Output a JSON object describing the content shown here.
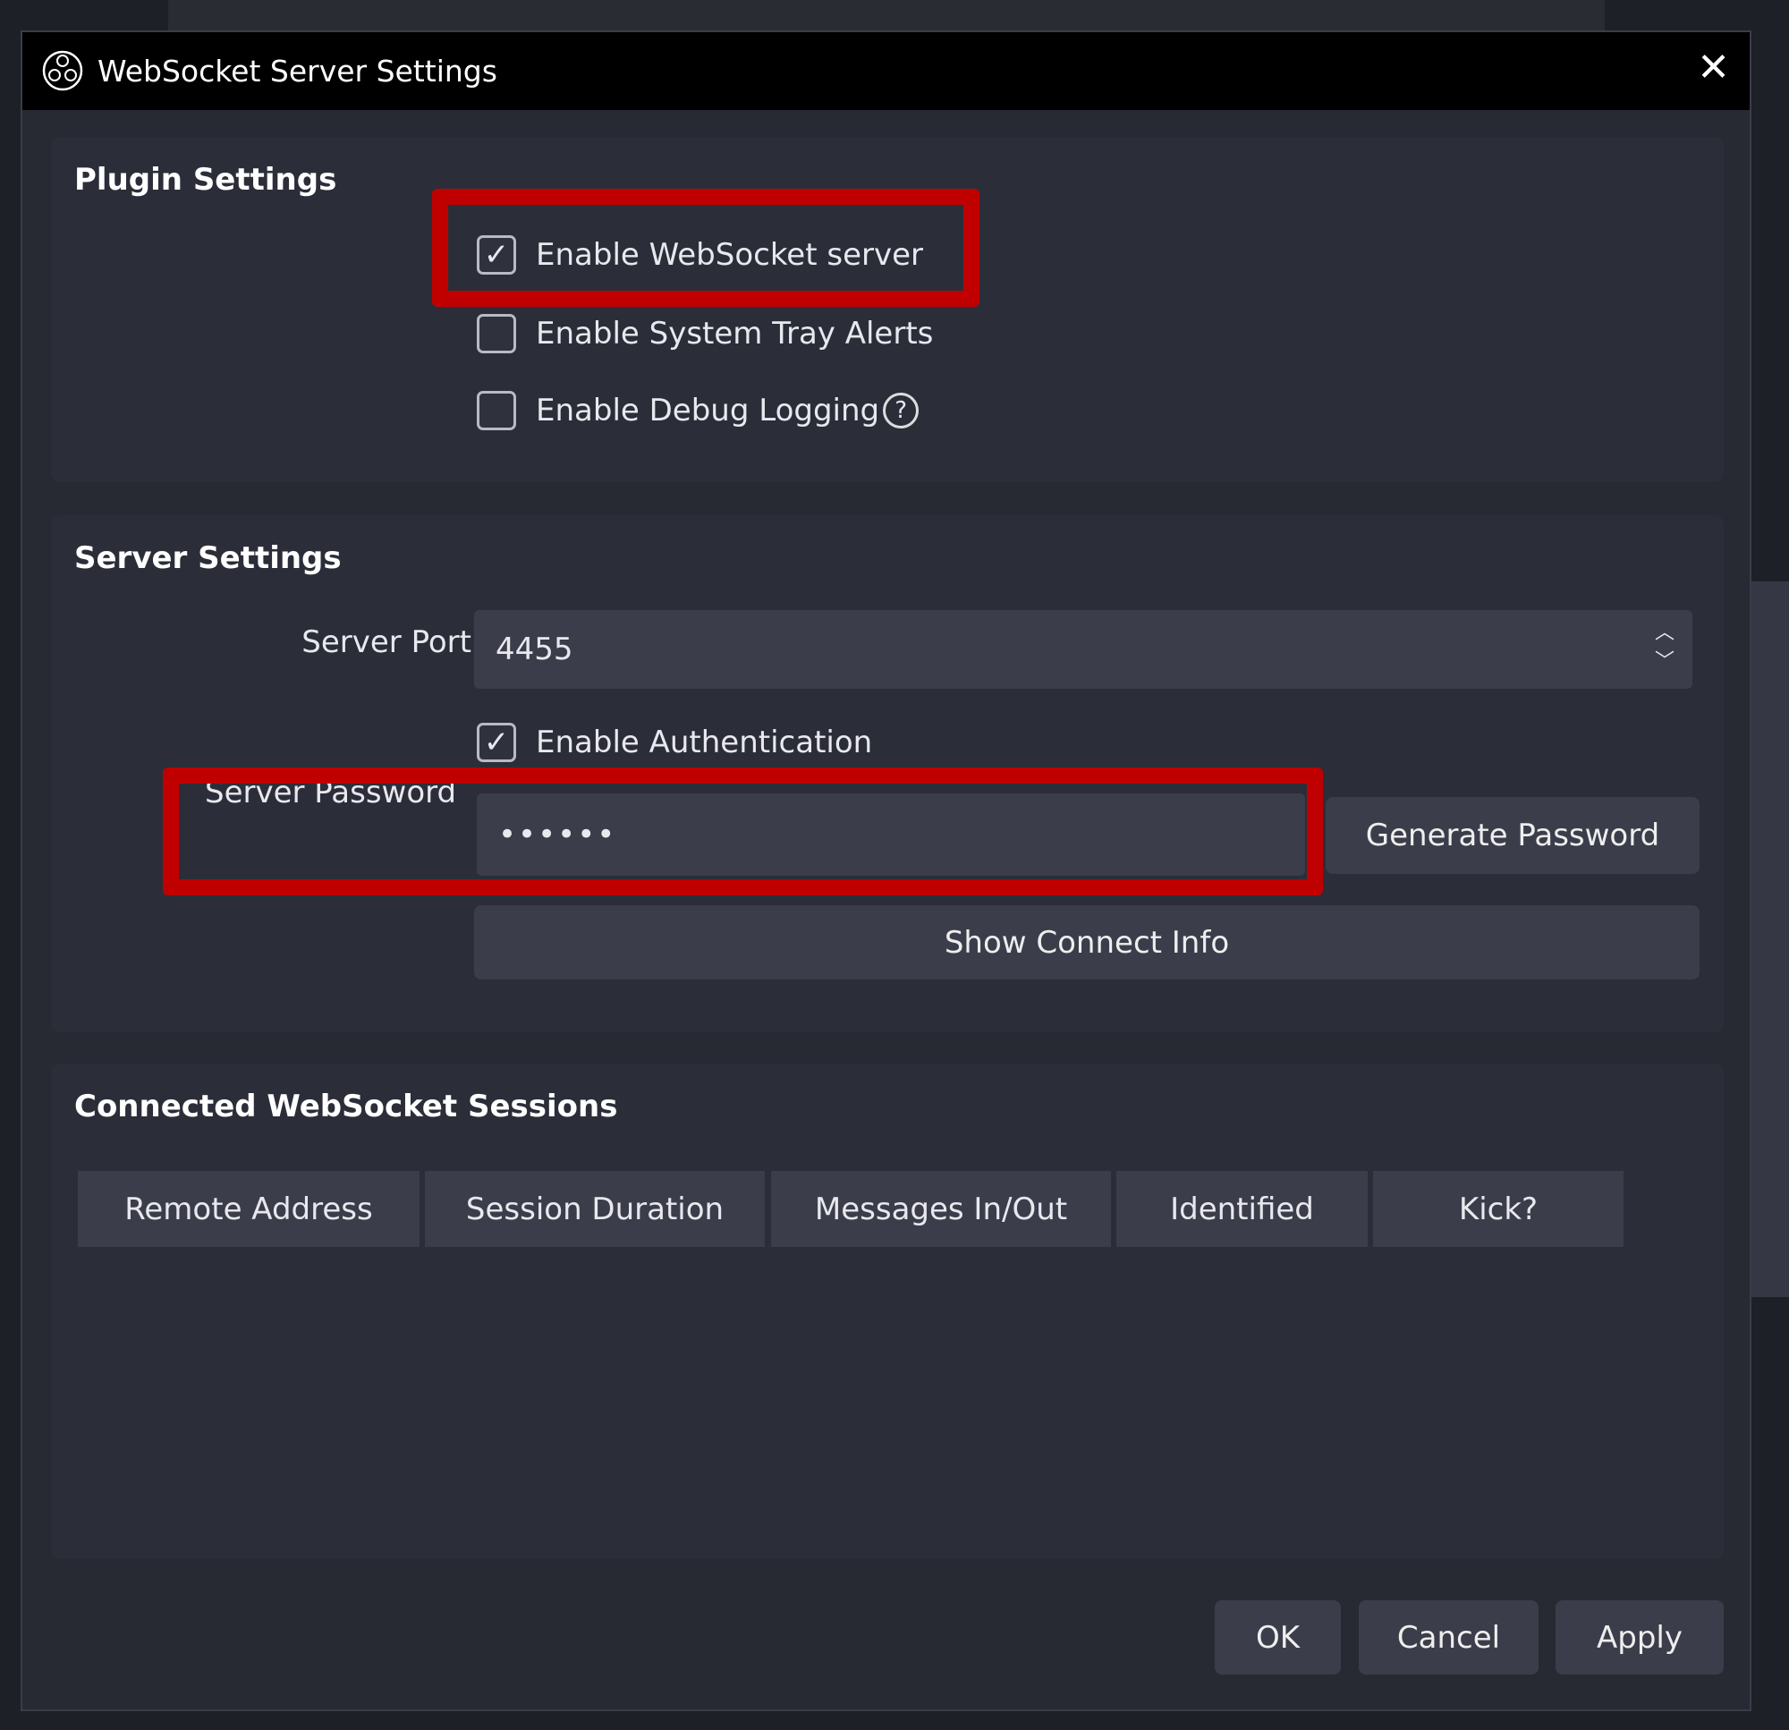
{
  "dialog": {
    "title": "WebSocket Server Settings",
    "icon": "obs-logo-icon",
    "close_icon": "close-icon"
  },
  "plugin_settings": {
    "heading": "Plugin Settings",
    "enable_server": {
      "label": "Enable WebSocket server",
      "checked": true
    },
    "enable_tray_alerts": {
      "label": "Enable System Tray Alerts",
      "checked": false
    },
    "enable_debug_logging": {
      "label": "Enable Debug Logging",
      "checked": false,
      "help_icon": "help-circle-icon"
    }
  },
  "server_settings": {
    "heading": "Server Settings",
    "port_label": "Server Port",
    "port_value": "4455",
    "enable_auth": {
      "label": "Enable Authentication",
      "checked": true
    },
    "password_label": "Server Password",
    "password_value": "••••••",
    "generate_password": "Generate Password",
    "show_connect_info": "Show Connect Info"
  },
  "sessions": {
    "heading": "Connected WebSocket Sessions",
    "columns": [
      "Remote Address",
      "Session Duration",
      "Messages In/Out",
      "Identified",
      "Kick?"
    ]
  },
  "buttons": {
    "ok": "OK",
    "cancel": "Cancel",
    "apply": "Apply"
  },
  "colors": {
    "highlight": "#c00000",
    "background": "#272a33",
    "input": "#3b3e4a"
  }
}
